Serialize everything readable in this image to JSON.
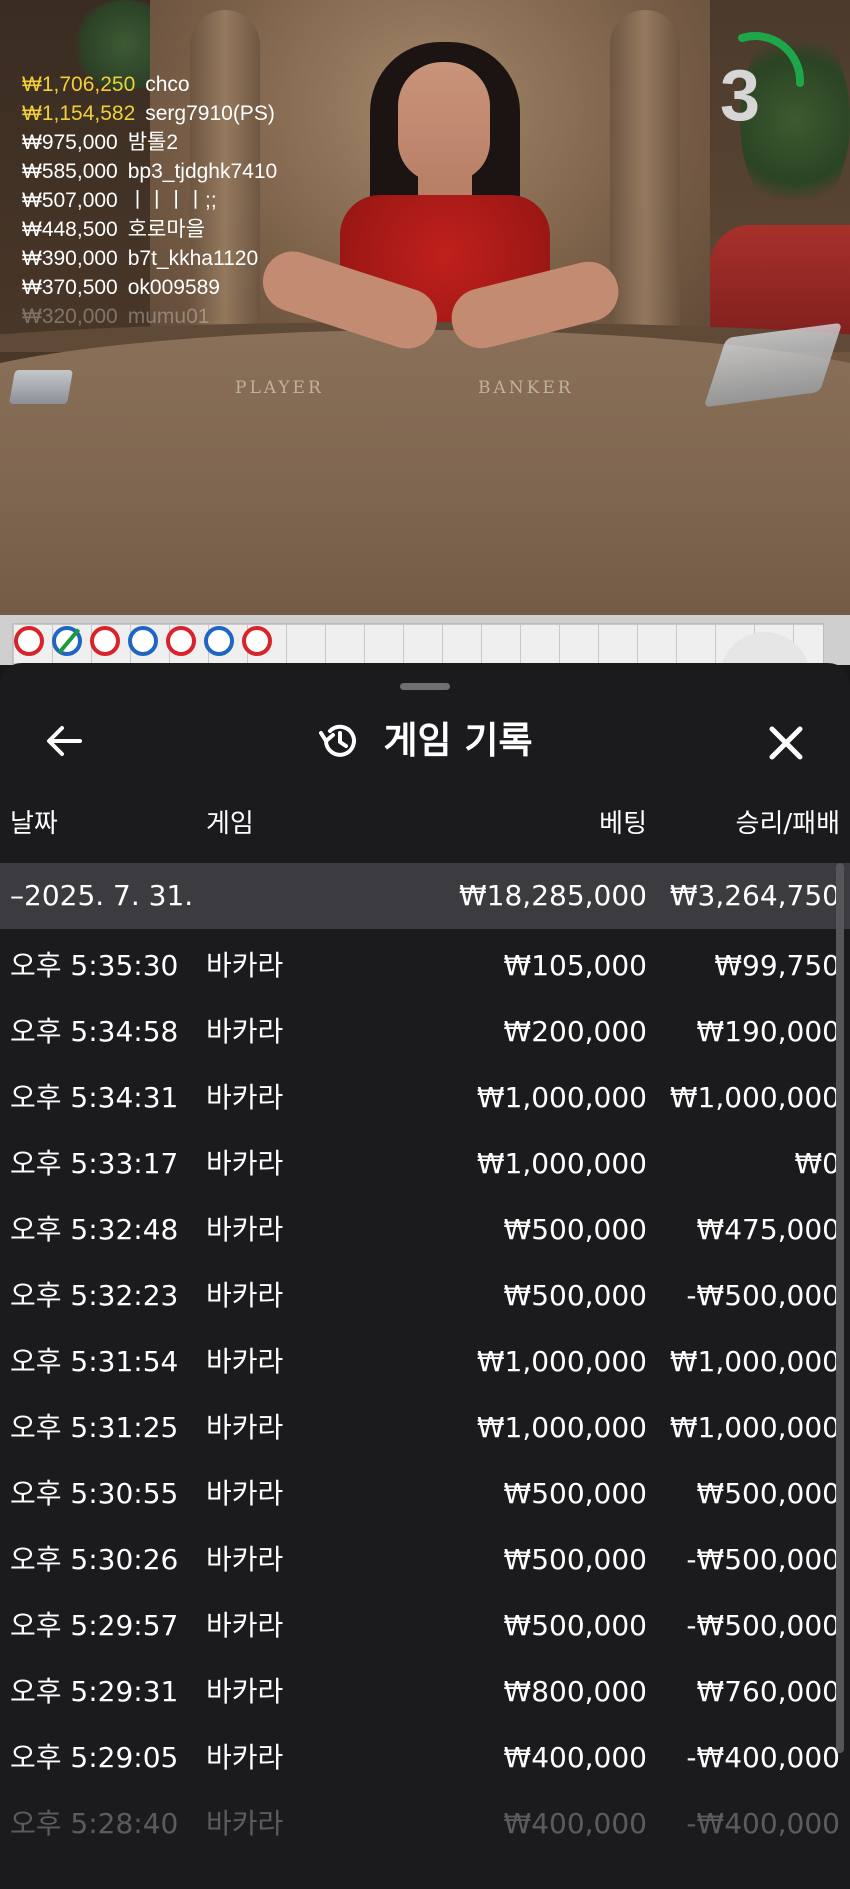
{
  "video": {
    "countdown": "3",
    "table_labels": {
      "player": "PLAYER",
      "banker": "BANKER"
    },
    "winners": [
      {
        "amount": "₩1,706,250",
        "name": "chco",
        "highlight": true
      },
      {
        "amount": "₩1,154,582",
        "name": "serg7910(PS)",
        "highlight": true
      },
      {
        "amount": "₩975,000",
        "name": "밤톨2",
        "highlight": false
      },
      {
        "amount": "₩585,000",
        "name": "bp3_tjdghk7410",
        "highlight": false
      },
      {
        "amount": "₩507,000",
        "name": "ㅣㅣㅣㅣ;;",
        "highlight": false
      },
      {
        "amount": "₩448,500",
        "name": "호로마을",
        "highlight": false
      },
      {
        "amount": "₩390,000",
        "name": "b7t_kkha1120",
        "highlight": false
      },
      {
        "amount": "₩370,500",
        "name": "ok009589",
        "highlight": false
      },
      {
        "amount": "₩320,000",
        "name": "mumu01",
        "highlight": false
      }
    ]
  },
  "roadmap": {
    "results": [
      {
        "color": "red",
        "tie": false
      },
      {
        "color": "blue",
        "tie": true
      },
      {
        "color": "red",
        "tie": false
      },
      {
        "color": "blue",
        "tie": false
      },
      {
        "color": "red",
        "tie": false
      },
      {
        "color": "blue",
        "tie": false
      },
      {
        "color": "red",
        "tie": false
      }
    ],
    "colors": {
      "red": "#d8232a",
      "blue": "#2065c4",
      "tie": "#1d9a3f"
    }
  },
  "panel": {
    "title": "게임 기록",
    "icons": {
      "back": "arrow-left-icon",
      "history": "history-icon",
      "close": "close-icon"
    },
    "columns": {
      "date": "날짜",
      "game": "게임",
      "bet": "베팅",
      "winloss": "승리/패배"
    },
    "summary": {
      "date": "–2025. 7. 31.",
      "bet": "₩18,285,000",
      "winloss": "₩3,264,750"
    },
    "rows": [
      {
        "time": "오후 5:35:30",
        "game": "바카라",
        "bet": "₩105,000",
        "winloss": "₩99,750"
      },
      {
        "time": "오후 5:34:58",
        "game": "바카라",
        "bet": "₩200,000",
        "winloss": "₩190,000"
      },
      {
        "time": "오후 5:34:31",
        "game": "바카라",
        "bet": "₩1,000,000",
        "winloss": "₩1,000,000"
      },
      {
        "time": "오후 5:33:17",
        "game": "바카라",
        "bet": "₩1,000,000",
        "winloss": "₩0"
      },
      {
        "time": "오후 5:32:48",
        "game": "바카라",
        "bet": "₩500,000",
        "winloss": "₩475,000"
      },
      {
        "time": "오후 5:32:23",
        "game": "바카라",
        "bet": "₩500,000",
        "winloss": "-₩500,000"
      },
      {
        "time": "오후 5:31:54",
        "game": "바카라",
        "bet": "₩1,000,000",
        "winloss": "₩1,000,000"
      },
      {
        "time": "오후 5:31:25",
        "game": "바카라",
        "bet": "₩1,000,000",
        "winloss": "₩1,000,000"
      },
      {
        "time": "오후 5:30:55",
        "game": "바카라",
        "bet": "₩500,000",
        "winloss": "₩500,000"
      },
      {
        "time": "오후 5:30:26",
        "game": "바카라",
        "bet": "₩500,000",
        "winloss": "-₩500,000"
      },
      {
        "time": "오후 5:29:57",
        "game": "바카라",
        "bet": "₩500,000",
        "winloss": "-₩500,000"
      },
      {
        "time": "오후 5:29:31",
        "game": "바카라",
        "bet": "₩800,000",
        "winloss": "₩760,000"
      },
      {
        "time": "오후 5:29:05",
        "game": "바카라",
        "bet": "₩400,000",
        "winloss": "-₩400,000"
      },
      {
        "time": "오후 5:28:40",
        "game": "바카라",
        "bet": "₩400,000",
        "winloss": "-₩400,000"
      }
    ]
  }
}
